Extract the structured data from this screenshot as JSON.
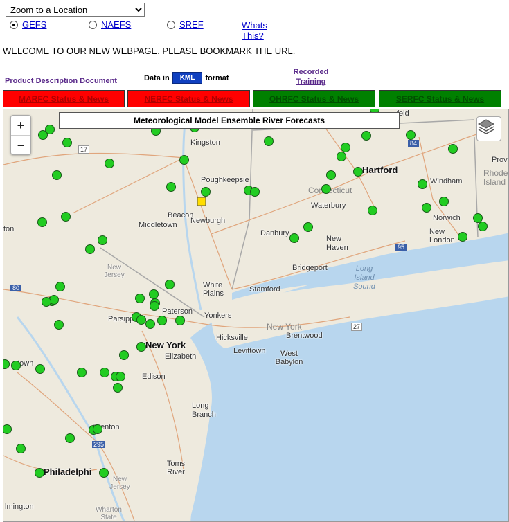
{
  "location_select": {
    "selected": "Zoom to a Location"
  },
  "models": [
    {
      "label": "GEFS",
      "selected": true
    },
    {
      "label": "NAEFS",
      "selected": false
    },
    {
      "label": "SREF",
      "selected": false
    }
  ],
  "whats_this": "Whats This?",
  "welcome": "WELCOME TO OUR NEW WEBPAGE. PLEASE BOOKMARK THE URL.",
  "product_doc": "Product Description Document",
  "kml": {
    "prefix": "Data in",
    "button": "KML",
    "suffix": "format"
  },
  "recorded_training": [
    "Recorded",
    "Training"
  ],
  "status_buttons": [
    {
      "label": "MARFC Status & News",
      "color": "#ff0000",
      "text_color": "#b00000"
    },
    {
      "label": "NERFC Status & News",
      "color": "#ff0000",
      "text_color": "#b00000"
    },
    {
      "label": "OHRFC Status & News",
      "color": "#008000",
      "text_color": "#005000"
    },
    {
      "label": "SERFC Status & News",
      "color": "#008000",
      "text_color": "#005000"
    }
  ],
  "map": {
    "title": "Meteorological Model Ensemble River Forecasts",
    "zoom_in": "+",
    "zoom_out": "−",
    "layers_icon": "layers-icon",
    "colors": {
      "gauge_normal": "#22cc22",
      "gauge_alert": "#ffdd00",
      "water": "#b8d6ee",
      "land": "#eeeade"
    },
    "labels": {
      "kingston": "Kingston",
      "poughkeepsie": "Poughkeepsie",
      "hartford": "Hartford",
      "connecticut": "Connecticut",
      "windham": "Windham",
      "rhode_island": "Rhode Island",
      "providence": "Prov",
      "beacon": "Beacon",
      "middletown": "Middletown",
      "newburgh": "Newburgh",
      "waterbury": "Waterbury",
      "norwich": "Norwich",
      "new_london": "New London",
      "danbury": "Danbury",
      "new_haven": "New Haven",
      "bridgeport": "Bridgeport",
      "long_island_sound": "Long Island Sound",
      "new_jersey": "New Jersey",
      "white_plains": "White Plains",
      "stamford": "Stamford",
      "paterson": "Paterson",
      "yonkers": "Yonkers",
      "parsippany": "Parsipp",
      "new_york_state": "New York",
      "new_york": "New York",
      "hicksville": "Hicksville",
      "brentwood": "Brentwood",
      "levittown": "Levittown",
      "west_babylon": "West Babylon",
      "elizabeth": "Elizabeth",
      "edison": "Edison",
      "allentown": "ntown",
      "long_branch": "Long Branch",
      "trenton": "Trenton",
      "toms_river": "Toms River",
      "philadelphia": "Philadelphi",
      "new_jersey_south": "New Jersey",
      "wharton": "Wharton State",
      "wilmington": "lmington",
      "left_edge_ton": "ton",
      "feld": "feld",
      "i17": "17",
      "i84": "84",
      "i95": "95",
      "i80": "80",
      "i27": "27",
      "i295": "295"
    }
  }
}
